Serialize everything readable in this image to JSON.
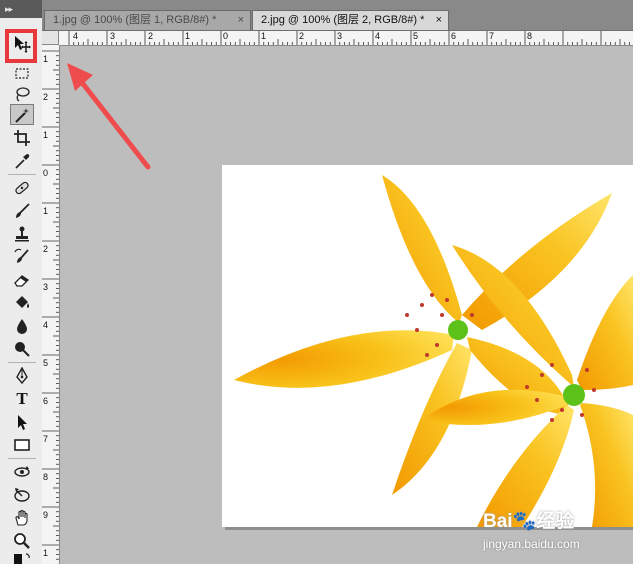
{
  "toolbox": {
    "grip": "▸▸",
    "tools": [
      {
        "name": "move-tool",
        "icon": "move-icon"
      },
      {
        "name": "marquee-tool",
        "icon": "marquee-icon"
      },
      {
        "name": "lasso-tool",
        "icon": "lasso-icon"
      },
      {
        "name": "magic-wand-tool",
        "icon": "magic-wand-icon"
      },
      {
        "name": "crop-tool",
        "icon": "crop-icon"
      },
      {
        "name": "eyedropper-tool",
        "icon": "eyedropper-icon"
      },
      {
        "name": "healing-brush-tool",
        "icon": "bandage-icon"
      },
      {
        "name": "brush-tool",
        "icon": "brush-icon"
      },
      {
        "name": "clone-stamp-tool",
        "icon": "stamp-icon"
      },
      {
        "name": "history-brush-tool",
        "icon": "history-brush-icon"
      },
      {
        "name": "eraser-tool",
        "icon": "eraser-icon"
      },
      {
        "name": "paint-bucket-tool",
        "icon": "bucket-icon"
      },
      {
        "name": "blur-tool",
        "icon": "drop-icon"
      },
      {
        "name": "dodge-tool",
        "icon": "dodge-icon"
      },
      {
        "name": "pen-tool",
        "icon": "pen-icon"
      },
      {
        "name": "type-tool",
        "icon": "type-icon",
        "label": "T"
      },
      {
        "name": "path-selection-tool",
        "icon": "arrow-icon"
      },
      {
        "name": "shape-tool",
        "icon": "rectangle-icon"
      },
      {
        "name": "3d-rotate-tool",
        "icon": "3d-rotate-icon"
      },
      {
        "name": "3d-orbit-tool",
        "icon": "3d-orbit-icon"
      },
      {
        "name": "hand-tool",
        "icon": "hand-icon"
      },
      {
        "name": "zoom-tool",
        "icon": "zoom-icon"
      },
      {
        "name": "color-swatches",
        "icon": "swatch-icon"
      }
    ],
    "active_tool": "magic-wand-tool",
    "highlighted_tool": "move-tool"
  },
  "tabs": [
    {
      "label": "1.jpg @ 100% (图层 1, RGB/8#) *",
      "close": "×",
      "active": false
    },
    {
      "label": "2.jpg @ 100% (图层 2, RGB/8#) *",
      "close": "×",
      "active": true
    }
  ],
  "rulers": {
    "top": [
      "4",
      "3",
      "2",
      "1",
      "0",
      "1",
      "2",
      "3",
      "4",
      "5",
      "6",
      "7",
      "8"
    ],
    "left": [
      "1",
      "2",
      "1",
      "0",
      "1",
      "2",
      "3",
      "4",
      "5",
      "6",
      "7",
      "8",
      "9",
      "1"
    ]
  },
  "watermark": {
    "logo": "Bai🐾经验",
    "url": "jingyan.baidu.com"
  },
  "colors": {
    "highlight": "#e8383b",
    "arrow": "#ef4d4d",
    "petal": "#f7b500",
    "petal_light": "#ffd84a",
    "center_green": "#5cc21a"
  }
}
